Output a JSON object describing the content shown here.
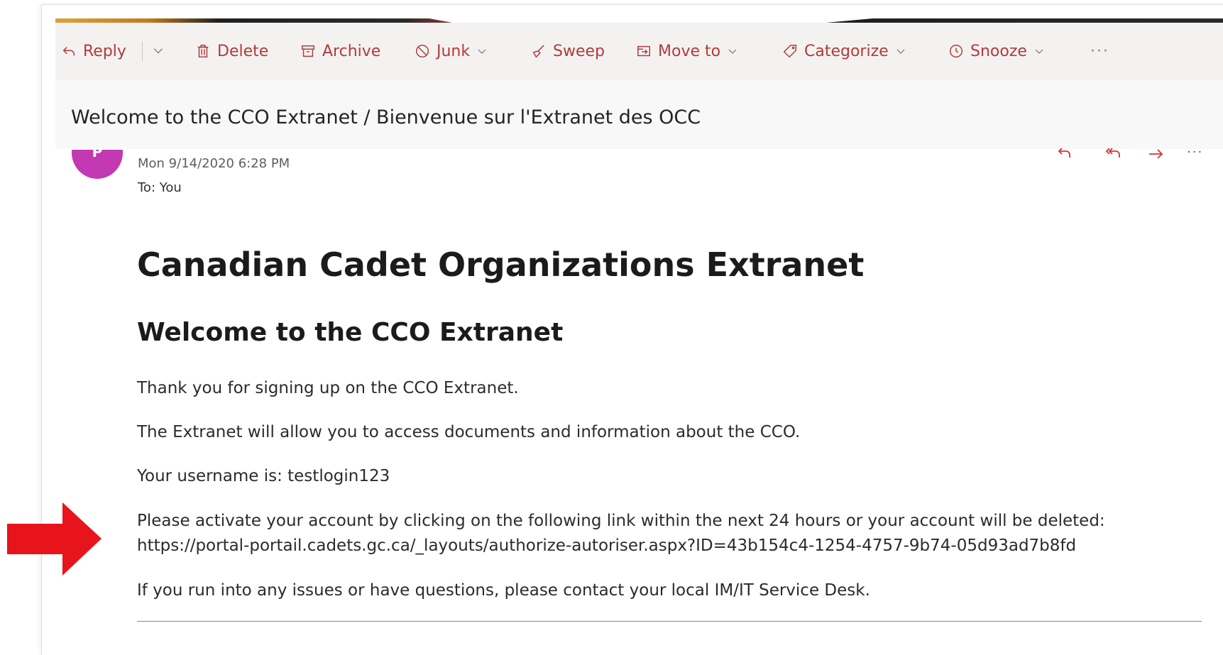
{
  "toolbar": {
    "reply": "Reply",
    "delete": "Delete",
    "archive": "Archive",
    "junk": "Junk",
    "sweep": "Sweep",
    "move_to": "Move to",
    "categorize": "Categorize",
    "snooze": "Snooze",
    "more": "···"
  },
  "email": {
    "subject": "Welcome to the CCO Extranet / Bienvenue sur l'Extranet des OCC",
    "avatar_initial": "P",
    "date": "Mon 9/14/2020 6:28 PM",
    "to": "To:  You",
    "more_actions": "···"
  },
  "body": {
    "heading": "Canadian Cadet Organizations Extranet",
    "subheading": "Welcome to the CCO Extranet",
    "thanks": "Thank you for signing up on the CCO Extranet.",
    "access": "The Extranet will allow you to access documents and information about the CCO.",
    "username": "Your username is: testlogin123",
    "activate": "Please activate your account by clicking on the following link within the next 24 hours or your account will be deleted:",
    "link": "https://portal-portail.cadets.gc.ca/_layouts/authorize-autoriser.aspx?ID=43b154c4-1254-4757-9b74-05d93ad7b8fd",
    "contact": "If you run into any issues or have questions, please contact your local IM/IT Service Desk."
  },
  "colors": {
    "accent": "#b33a3a",
    "avatar": "#c239b3",
    "annotation_arrow": "#e8141b"
  },
  "icons": [
    "reply-icon",
    "delete-icon",
    "archive-icon",
    "junk-icon",
    "sweep-icon",
    "move-to-icon",
    "categorize-icon",
    "snooze-icon",
    "reply-action-icon",
    "reply-all-icon",
    "forward-icon",
    "annotation-arrow"
  ]
}
